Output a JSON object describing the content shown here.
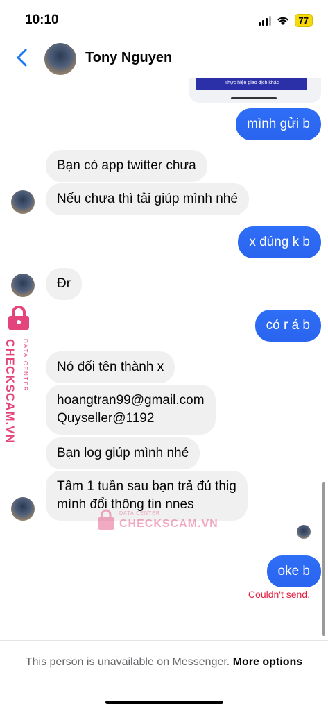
{
  "status_bar": {
    "time": "10:10",
    "battery": "77"
  },
  "header": {
    "contact_name": "Tony Nguyen"
  },
  "previous_card": {
    "button_text": "Thực hiện giao dịch khác"
  },
  "messages": [
    {
      "text": "mình gửi b",
      "direction": "out"
    },
    {
      "text": "Bạn có app twitter chưa",
      "direction": "in"
    },
    {
      "text": "Nếu chưa thì tải giúp mình nhé",
      "direction": "in"
    },
    {
      "text": "x đúng k b",
      "direction": "out"
    },
    {
      "text": "Đr",
      "direction": "in"
    },
    {
      "text": "có r á b",
      "direction": "out"
    },
    {
      "text": "Nó đổi tên thành x",
      "direction": "in"
    },
    {
      "line1": "hoangtran99@gmail.com",
      "line2": "Quyseller@1192",
      "direction": "in"
    },
    {
      "text": "Bạn log giúp mình nhé",
      "direction": "in"
    },
    {
      "line1": "Tầm 1 tuần sau bạn trả đủ thig",
      "line2": "mình đổi thông tin nnes",
      "direction": "in"
    },
    {
      "text": "oke b",
      "direction": "out"
    }
  ],
  "send_error": "Couldn't send.",
  "footer": {
    "text": "This person is unavailable on Messenger.",
    "link": "More options"
  },
  "watermark": {
    "brand": "CHECKSCAM.VN",
    "sub": "DATA CENTER"
  },
  "colors": {
    "accent": "#2a64ef",
    "incoming_bubble": "#f0f0f0",
    "error": "#e41e3f",
    "watermark": "#e3447c"
  },
  "icons": {
    "back": "chevron-left-icon"
  }
}
